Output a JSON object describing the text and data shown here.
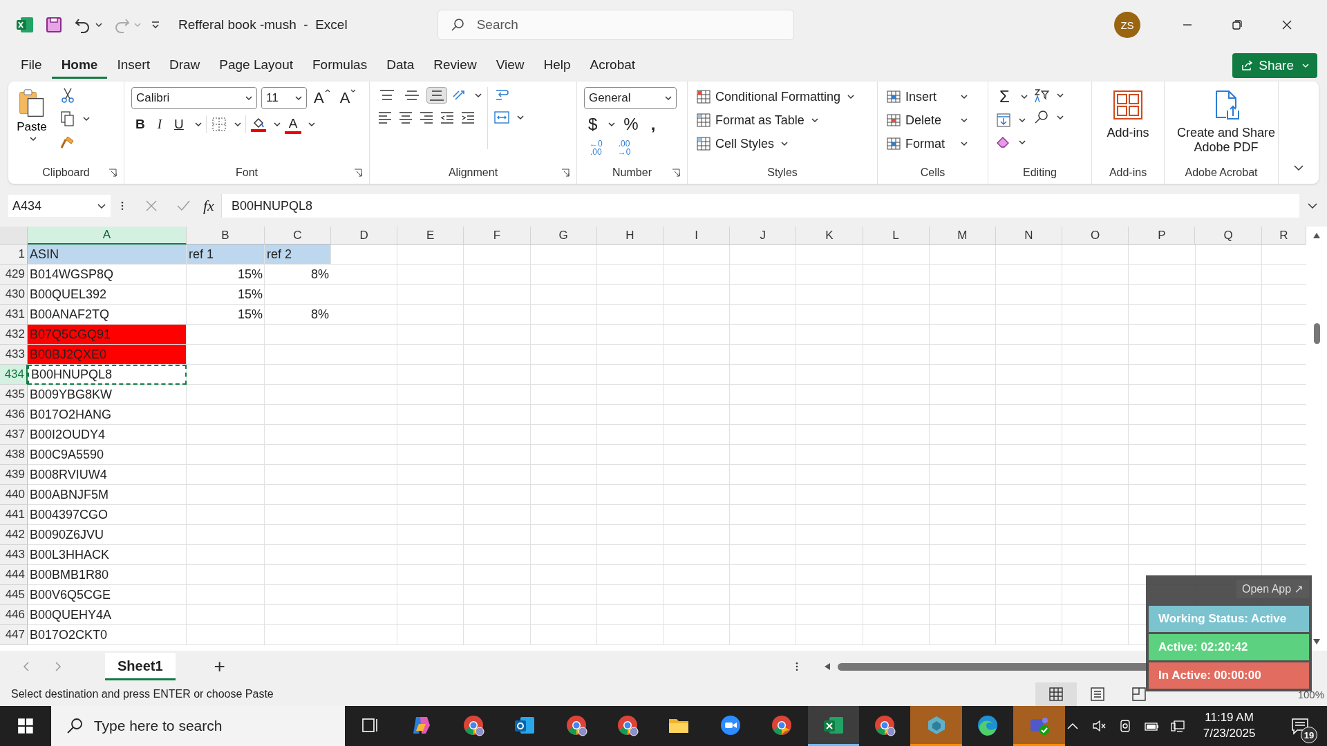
{
  "title_bar": {
    "document_title": "Refferal book -mush  -  Excel",
    "search_placeholder": "Search",
    "avatar_initials": "ZS"
  },
  "ribbon_tabs": [
    {
      "label": "File",
      "selected": false
    },
    {
      "label": "Home",
      "selected": true
    },
    {
      "label": "Insert",
      "selected": false
    },
    {
      "label": "Draw",
      "selected": false
    },
    {
      "label": "Page Layout",
      "selected": false
    },
    {
      "label": "Formulas",
      "selected": false
    },
    {
      "label": "Data",
      "selected": false
    },
    {
      "label": "Review",
      "selected": false
    },
    {
      "label": "View",
      "selected": false
    },
    {
      "label": "Help",
      "selected": false
    },
    {
      "label": "Acrobat",
      "selected": false
    }
  ],
  "share_button": "Share",
  "ribbon": {
    "clipboard": {
      "label": "Clipboard",
      "paste": "Paste"
    },
    "font": {
      "label": "Font",
      "font_name": "Calibri",
      "font_size": "11",
      "grow": "A",
      "shrink": "A",
      "bold": "B",
      "italic": "I",
      "underline": "U",
      "font_color": "A"
    },
    "alignment": {
      "label": "Alignment",
      "vertical_buttons": [
        {
          "kind": "top",
          "selected": false
        },
        {
          "kind": "middle",
          "selected": false
        },
        {
          "kind": "bottom",
          "selected": true
        }
      ]
    },
    "number": {
      "label": "Number",
      "format": "General",
      "currency": "$",
      "percent": "%",
      "comma": ",",
      "increase_decimal": [
        "←0",
        ".00"
      ],
      "decrease_decimal": [
        ".00",
        "→0"
      ]
    },
    "styles": {
      "label": "Styles",
      "items": [
        "Conditional Formatting",
        "Format as Table",
        "Cell Styles"
      ]
    },
    "cells": {
      "label": "Cells",
      "items": [
        "Insert",
        "Delete",
        "Format"
      ]
    },
    "editing": {
      "label": "Editing",
      "sum": "Σ"
    },
    "addins": {
      "label": "Add-ins",
      "button": "Add-ins"
    },
    "acrobat": {
      "label": "Adobe Acrobat",
      "button": "Create and Share Adobe PDF"
    }
  },
  "formula_bar": {
    "name_box": "A434",
    "fx": "fx",
    "value": "B00HNUPQL8"
  },
  "grid": {
    "columns": [
      {
        "label": "A",
        "selected": true
      },
      {
        "label": "B",
        "selected": false
      },
      {
        "label": "C",
        "selected": false
      },
      {
        "label": "D",
        "selected": false
      },
      {
        "label": "E",
        "selected": false
      },
      {
        "label": "F",
        "selected": false
      },
      {
        "label": "G",
        "selected": false
      },
      {
        "label": "H",
        "selected": false
      },
      {
        "label": "I",
        "selected": false
      },
      {
        "label": "J",
        "selected": false
      },
      {
        "label": "K",
        "selected": false
      },
      {
        "label": "L",
        "selected": false
      },
      {
        "label": "M",
        "selected": false
      },
      {
        "label": "N",
        "selected": false
      },
      {
        "label": "O",
        "selected": false
      },
      {
        "label": "P",
        "selected": false
      },
      {
        "label": "Q",
        "selected": false
      },
      {
        "label": "R",
        "selected": false
      }
    ],
    "header_row": {
      "number": "1",
      "cells": [
        "ASIN",
        "ref 1",
        "ref 2"
      ]
    },
    "rows": [
      {
        "number": "429",
        "asin": "B014WGSP8Q",
        "ref_1": "15%",
        "ref_2": "8%",
        "highlighted": false,
        "selected": false
      },
      {
        "number": "430",
        "asin": "B00QUEL392",
        "ref_1": "15%",
        "highlighted": false,
        "selected": false
      },
      {
        "number": "431",
        "asin": "B00ANAF2TQ",
        "ref_1": "15%",
        "ref_2": "8%",
        "highlighted": false,
        "selected": false
      },
      {
        "number": "432",
        "asin": "B07Q5CGQ91",
        "highlighted": true,
        "selected": false
      },
      {
        "number": "433",
        "asin": "B00BJ2QXE0",
        "highlighted": true,
        "selected": false
      },
      {
        "number": "434",
        "asin": "B00HNUPQL8",
        "highlighted": false,
        "selected": true
      },
      {
        "number": "435",
        "asin": "B009YBG8KW",
        "highlighted": false,
        "selected": false
      },
      {
        "number": "436",
        "asin": "B017O2HANG",
        "highlighted": false,
        "selected": false
      },
      {
        "number": "437",
        "asin": "B00I2OUDY4",
        "highlighted": false,
        "selected": false
      },
      {
        "number": "438",
        "asin": "B00C9A5590",
        "highlighted": false,
        "selected": false
      },
      {
        "number": "439",
        "asin": "B008RVIUW4",
        "highlighted": false,
        "selected": false
      },
      {
        "number": "440",
        "asin": "B00ABNJF5M",
        "highlighted": false,
        "selected": false
      },
      {
        "number": "441",
        "asin": "B004397CGO",
        "highlighted": false,
        "selected": false
      },
      {
        "number": "442",
        "asin": "B0090Z6JVU",
        "highlighted": false,
        "selected": false
      },
      {
        "number": "443",
        "asin": "B00L3HHACK",
        "highlighted": false,
        "selected": false
      },
      {
        "number": "444",
        "asin": "B00BMB1R80",
        "highlighted": false,
        "selected": false
      },
      {
        "number": "445",
        "asin": "B00V6Q5CGE",
        "highlighted": false,
        "selected": false
      },
      {
        "number": "446",
        "asin": "B00QUEHY4A",
        "highlighted": false,
        "selected": false
      },
      {
        "number": "447",
        "asin": "B017O2CKT0",
        "highlighted": false,
        "selected": false
      }
    ]
  },
  "sheet_tabs": [
    {
      "label": "Sheet1",
      "selected": true
    }
  ],
  "add_sheet": "+",
  "status_bar": {
    "message": "Select destination and press ENTER or choose Paste",
    "zoom": "100%"
  },
  "tracker": {
    "open_app": "Open App ↗",
    "items": [
      {
        "text": "Working Status: Active",
        "color": "#7cc3d0"
      },
      {
        "text": "Active: 02:20:42",
        "color": "#5cd17f"
      },
      {
        "text": "In Active: 00:00:00",
        "color": "#e26c60"
      }
    ]
  },
  "taskbar": {
    "search_placeholder": "Type here to search",
    "time": "11:19 AM",
    "date": "7/23/2025",
    "notifications": "19",
    "apps": [
      {
        "kind": "task-view",
        "selected": false,
        "flashing": false
      },
      {
        "kind": "copilot",
        "selected": false,
        "flashing": false
      },
      {
        "kind": "chrome-profile",
        "selected": false,
        "flashing": false
      },
      {
        "kind": "outlook",
        "selected": false,
        "flashing": false
      },
      {
        "kind": "chrome-profile",
        "selected": false,
        "flashing": false
      },
      {
        "kind": "chrome-profile",
        "selected": false,
        "flashing": false
      },
      {
        "kind": "folder",
        "selected": false,
        "flashing": false
      },
      {
        "kind": "zoom",
        "selected": false,
        "flashing": false
      },
      {
        "kind": "chrome",
        "selected": false,
        "flashing": false
      },
      {
        "kind": "excel",
        "selected": true,
        "flashing": false
      },
      {
        "kind": "chrome-profile",
        "selected": false,
        "flashing": false
      },
      {
        "kind": "cube",
        "selected": false,
        "flashing": true
      },
      {
        "kind": "edge",
        "selected": false,
        "flashing": false
      },
      {
        "kind": "teams",
        "selected": false,
        "flashing": true
      }
    ]
  }
}
